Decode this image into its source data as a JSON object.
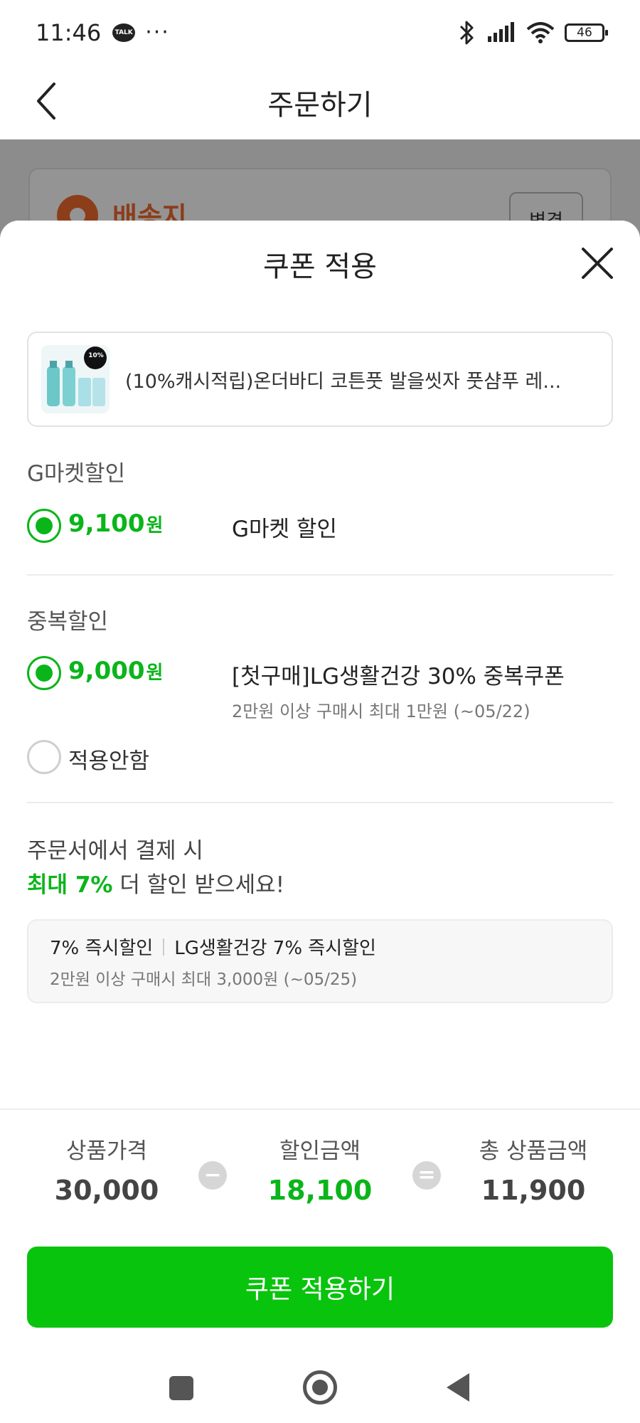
{
  "status_bar": {
    "time": "11:46",
    "talk_badge": "TALK",
    "dots": "···",
    "battery": "46"
  },
  "header": {
    "title": "주문하기"
  },
  "background_page": {
    "address_label": "배송지",
    "change_button": "변경"
  },
  "sheet": {
    "title": "쿠폰 적용",
    "product": {
      "name": "(10%캐시적립)온더바디 코튼풋 발을씻자 풋샴푸 레...",
      "thumb_badge": "10%"
    },
    "gmarket_section": {
      "label": "G마켓할인",
      "option": {
        "amount": "9,100",
        "unit": "원",
        "name": "G마켓 할인",
        "selected": true
      }
    },
    "duplicate_section": {
      "label": "중복할인",
      "coupon": {
        "amount": "9,000",
        "unit": "원",
        "name": "[첫구매]LG생활건강 30% 중복쿠폰",
        "desc": "2만원 이상 구매시 최대 1만원 (~05/22)",
        "selected": true
      },
      "none_option": {
        "label": "적용안함",
        "selected": false
      }
    },
    "promo": {
      "line1": "주문서에서 결제 시",
      "highlight": "최대 7%",
      "line2_rest": " 더 할인 받으세요!",
      "box_title": "7% 즉시할인",
      "box_brand": "LG생활건강 7% 즉시할인",
      "box_desc": "2만원 이상 구매시 최대 3,000원 (~05/25)"
    },
    "summary": {
      "price_label": "상품가격",
      "price_value": "30,000",
      "minus": "−",
      "discount_label": "할인금액",
      "discount_value": "18,100",
      "equals": "=",
      "total_label": "총 상품금액",
      "total_value": "11,900"
    },
    "apply_button": "쿠폰 적용하기"
  },
  "colors": {
    "accent_green": "#0ab51a",
    "button_green": "#08c40c",
    "address_orange": "#f26a2d"
  }
}
